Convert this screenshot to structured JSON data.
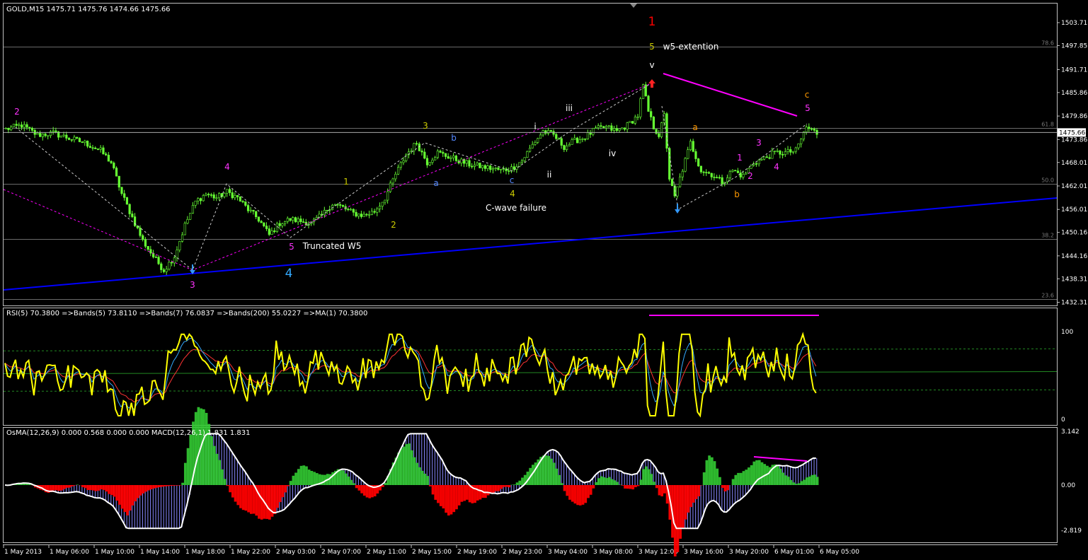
{
  "window": {
    "price_header": "GOLD,M15  1475.71 1475.76 1474.66 1475.66",
    "rsi_header": "RSI(5) 70.3800  =>Bands(5) 73.8110  =>Bands(7) 76.0837  =>Bands(200) 55.0227  =>MA(1) 70.3800",
    "macd_header": "OsMA(12,26,9) 0.000 0.568 0.000 0.000  MACD(12,26,1) 1.831 1.831"
  },
  "colors": {
    "background": "#000000",
    "grid": "#c0c0c0",
    "candles": "#66ff33",
    "trendline": "#0000ff",
    "rsi_line": "#ffff00",
    "divergence": "#ff00ff",
    "osma_up": "#33cc33",
    "osma_down": "#ff0000",
    "macd_line": "#ffffff",
    "macd_hist": "#8888ff"
  },
  "chart_data": [
    {
      "type": "candlestick",
      "symbol": "GOLD",
      "timeframe": "M15",
      "ylim": [
        1432.31,
        1506.0
      ],
      "y_ticks": [
        "1503.71",
        "1497.85",
        "1491.71",
        "1485.86",
        "1479.86",
        "1473.86",
        "1468.01",
        "1462.01",
        "1456.01",
        "1450.16",
        "1444.16",
        "1438.31",
        "1432.31"
      ],
      "current_price": "1475.66",
      "fib_levels": [
        {
          "label": "78.6",
          "price": 1497.5
        },
        {
          "label": "61.8",
          "price": 1476.8
        },
        {
          "label": "50.0",
          "price": 1462.5
        },
        {
          "label": "38.2",
          "price": 1448.4
        },
        {
          "label": "23.6",
          "price": 1433.2
        }
      ],
      "x_labels": [
        "1 May 2013",
        "1 May 06:00",
        "1 May 10:00",
        "1 May 14:00",
        "1 May 18:00",
        "1 May 22:00",
        "2 May 03:00",
        "2 May 07:00",
        "2 May 11:00",
        "2 May 15:00",
        "2 May 19:00",
        "2 May 23:00",
        "3 May 04:00",
        "3 May 08:00",
        "3 May 12:00",
        "3 May 16:00",
        "3 May 20:00",
        "6 May 01:00",
        "6 May 05:00"
      ],
      "close_path": [
        [
          0,
          1476.5
        ],
        [
          6,
          1477.5
        ],
        [
          12,
          1475.0
        ],
        [
          18,
          1475.5
        ],
        [
          24,
          1474.2
        ],
        [
          30,
          1473.0
        ],
        [
          36,
          1471.0
        ],
        [
          40,
          1468.0
        ],
        [
          44,
          1460.0
        ],
        [
          48,
          1454.0
        ],
        [
          52,
          1448.0
        ],
        [
          56,
          1444.0
        ],
        [
          60,
          1440.5
        ],
        [
          64,
          1444.0
        ],
        [
          68,
          1452.0
        ],
        [
          72,
          1458.0
        ],
        [
          76,
          1460.0
        ],
        [
          80,
          1459.0
        ],
        [
          84,
          1460.5
        ],
        [
          88,
          1459.0
        ],
        [
          92,
          1456.0
        ],
        [
          96,
          1453.5
        ],
        [
          100,
          1449.5
        ],
        [
          104,
          1452.5
        ],
        [
          108,
          1453.5
        ],
        [
          112,
          1453.0
        ],
        [
          116,
          1452.5
        ],
        [
          120,
          1454.5
        ],
        [
          124,
          1457.5
        ],
        [
          128,
          1456.5
        ],
        [
          132,
          1455.0
        ],
        [
          136,
          1454.5
        ],
        [
          140,
          1455.5
        ],
        [
          144,
          1459.0
        ],
        [
          148,
          1465.0
        ],
        [
          152,
          1470.0
        ],
        [
          156,
          1473.0
        ],
        [
          160,
          1468.0
        ],
        [
          164,
          1470.5
        ],
        [
          168,
          1469.5
        ],
        [
          172,
          1468.5
        ],
        [
          176,
          1467.5
        ],
        [
          180,
          1467.0
        ],
        [
          184,
          1466.5
        ],
        [
          188,
          1466.0
        ],
        [
          192,
          1466.5
        ],
        [
          196,
          1468.5
        ],
        [
          200,
          1472.5
        ],
        [
          204,
          1476.0
        ],
        [
          208,
          1475.0
        ],
        [
          212,
          1472.0
        ],
        [
          216,
          1473.5
        ],
        [
          220,
          1474.5
        ],
        [
          224,
          1476.5
        ],
        [
          228,
          1477.0
        ],
        [
          232,
          1476.0
        ],
        [
          236,
          1477.5
        ],
        [
          240,
          1480.0
        ],
        [
          242,
          1487.5
        ],
        [
          244,
          1481.0
        ],
        [
          246,
          1477.0
        ],
        [
          248,
          1475.0
        ],
        [
          250,
          1480.0
        ],
        [
          252,
          1464.0
        ],
        [
          254,
          1459.0
        ],
        [
          256,
          1464.0
        ],
        [
          260,
          1473.0
        ],
        [
          264,
          1466.0
        ],
        [
          268,
          1465.0
        ],
        [
          272,
          1463.0
        ],
        [
          276,
          1466.0
        ],
        [
          280,
          1464.5
        ],
        [
          284,
          1468.0
        ],
        [
          288,
          1469.0
        ],
        [
          292,
          1470.5
        ],
        [
          296,
          1470.5
        ],
        [
          300,
          1471.0
        ],
        [
          304,
          1477.0
        ],
        [
          308,
          1475.5
        ]
      ],
      "annotations": [
        {
          "text": "1",
          "color": "#ff0000"
        },
        {
          "text": "5",
          "color": "#cccc00"
        },
        {
          "text": "w5-extention",
          "color": "#ffffff"
        },
        {
          "text": "v",
          "color": "#ffffff"
        },
        {
          "text": "c",
          "color": "#ff9900"
        },
        {
          "text": "5",
          "color": "#ff33ff"
        },
        {
          "text": "2",
          "color": "#ff33ff"
        },
        {
          "text": "iii",
          "color": "#ffffff"
        },
        {
          "text": "3",
          "color": "#cccc00"
        },
        {
          "text": "b",
          "color": "#5588ff"
        },
        {
          "text": "a",
          "color": "#ff9900"
        },
        {
          "text": "i",
          "color": "#ffffff"
        },
        {
          "text": "iv",
          "color": "#ffffff"
        },
        {
          "text": "ii",
          "color": "#ffffff"
        },
        {
          "text": "a",
          "color": "#5588ff"
        },
        {
          "text": "c",
          "color": "#5588ff"
        },
        {
          "text": "4",
          "color": "#cccc00"
        },
        {
          "text": "4",
          "color": "#ff33ff"
        },
        {
          "text": "1",
          "color": "#cccc00"
        },
        {
          "text": "C-wave failure",
          "color": "#ffffff"
        },
        {
          "text": "1",
          "color": "#ff33ff"
        },
        {
          "text": "3",
          "color": "#ff33ff"
        },
        {
          "text": "2",
          "color": "#ff33ff"
        },
        {
          "text": "4",
          "color": "#ff33ff"
        },
        {
          "text": "b",
          "color": "#ff9900"
        },
        {
          "text": "2",
          "color": "#cccc00"
        },
        {
          "text": "5",
          "color": "#ff33ff"
        },
        {
          "text": "Truncated W5",
          "color": "#ffffff"
        },
        {
          "text": "3",
          "color": "#ff33ff"
        },
        {
          "text": "4",
          "color": "#33aaff"
        }
      ]
    },
    {
      "type": "line",
      "name": "RSI(5)",
      "ylim": [
        0,
        100
      ],
      "y_ticks": [
        "100",
        "0"
      ],
      "levels": {
        "upper_band": 78,
        "middle": 52,
        "lower_band": 32
      }
    },
    {
      "type": "bar",
      "name": "OsMA(12,26,9) / MACD(12,26,1)",
      "ylim": [
        -2.819,
        3.142
      ],
      "y_ticks": [
        "3.142",
        "0.00",
        "-2.819"
      ]
    }
  ]
}
